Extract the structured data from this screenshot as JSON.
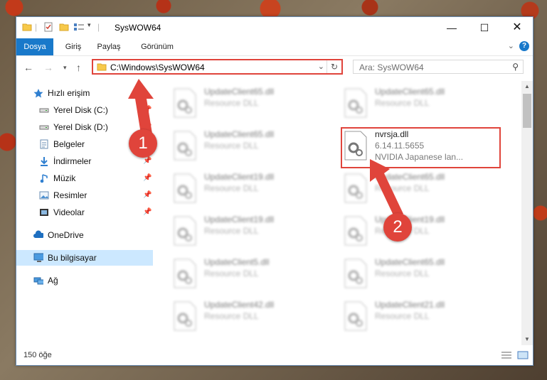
{
  "window": {
    "title": "SysWOW64"
  },
  "ribbon": {
    "tabs": [
      "Dosya",
      "Giriş",
      "Paylaş",
      "Görünüm"
    ]
  },
  "address": {
    "path": "C:\\Windows\\SysWOW64"
  },
  "search": {
    "placeholder": "Ara: SysWOW64"
  },
  "sidebar": {
    "quick_access": "Hızlı erişim",
    "items": [
      {
        "label": "Yerel Disk (C:)",
        "icon": "drive-icon"
      },
      {
        "label": "Yerel Disk (D:)",
        "icon": "drive-icon"
      },
      {
        "label": "Belgeler",
        "icon": "documents-icon"
      },
      {
        "label": "İndirmeler",
        "icon": "downloads-icon"
      },
      {
        "label": "Müzik",
        "icon": "music-icon"
      },
      {
        "label": "Resimler",
        "icon": "pictures-icon"
      },
      {
        "label": "Videolar",
        "icon": "videos-icon"
      }
    ],
    "onedrive": "OneDrive",
    "this_pc": "Bu bilgisayar",
    "network": "Ağ"
  },
  "files": {
    "left": [
      {
        "name": "UpdateClient65.dll",
        "type": "Resource DLL"
      },
      {
        "name": "UpdateClient65.dll",
        "type": "Resource DLL"
      },
      {
        "name": "UpdateClient19.dll",
        "type": "Resource DLL"
      },
      {
        "name": "UpdateClient19.dll",
        "type": "Resource DLL"
      },
      {
        "name": "UpdateClient5.dll",
        "type": "Resource DLL"
      },
      {
        "name": "UpdateClient42.dll",
        "type": "Resource DLL"
      }
    ],
    "right": [
      {
        "name": "UpdateClient65.dll",
        "type": "Resource DLL"
      },
      {
        "name": "UpdateClient65.dll",
        "type": "Resource DLL"
      },
      {
        "name": "UpdateClient19.dll",
        "type": "Resource DLL"
      },
      {
        "name": "UpdateClient65.dll",
        "type": "Resource DLL"
      },
      {
        "name": "UpdateClient21.dll",
        "type": "Resource DLL"
      }
    ],
    "highlighted": {
      "name": "nvrsja.dll",
      "version": "6.14.11.5655",
      "description": "NVIDIA Japanese lan..."
    }
  },
  "status": {
    "count": "150 öğe"
  },
  "annotations": {
    "step1": "1",
    "step2": "2"
  },
  "colors": {
    "accent": "#1979ca",
    "highlight": "#e0443b",
    "selection": "#cce8ff"
  }
}
